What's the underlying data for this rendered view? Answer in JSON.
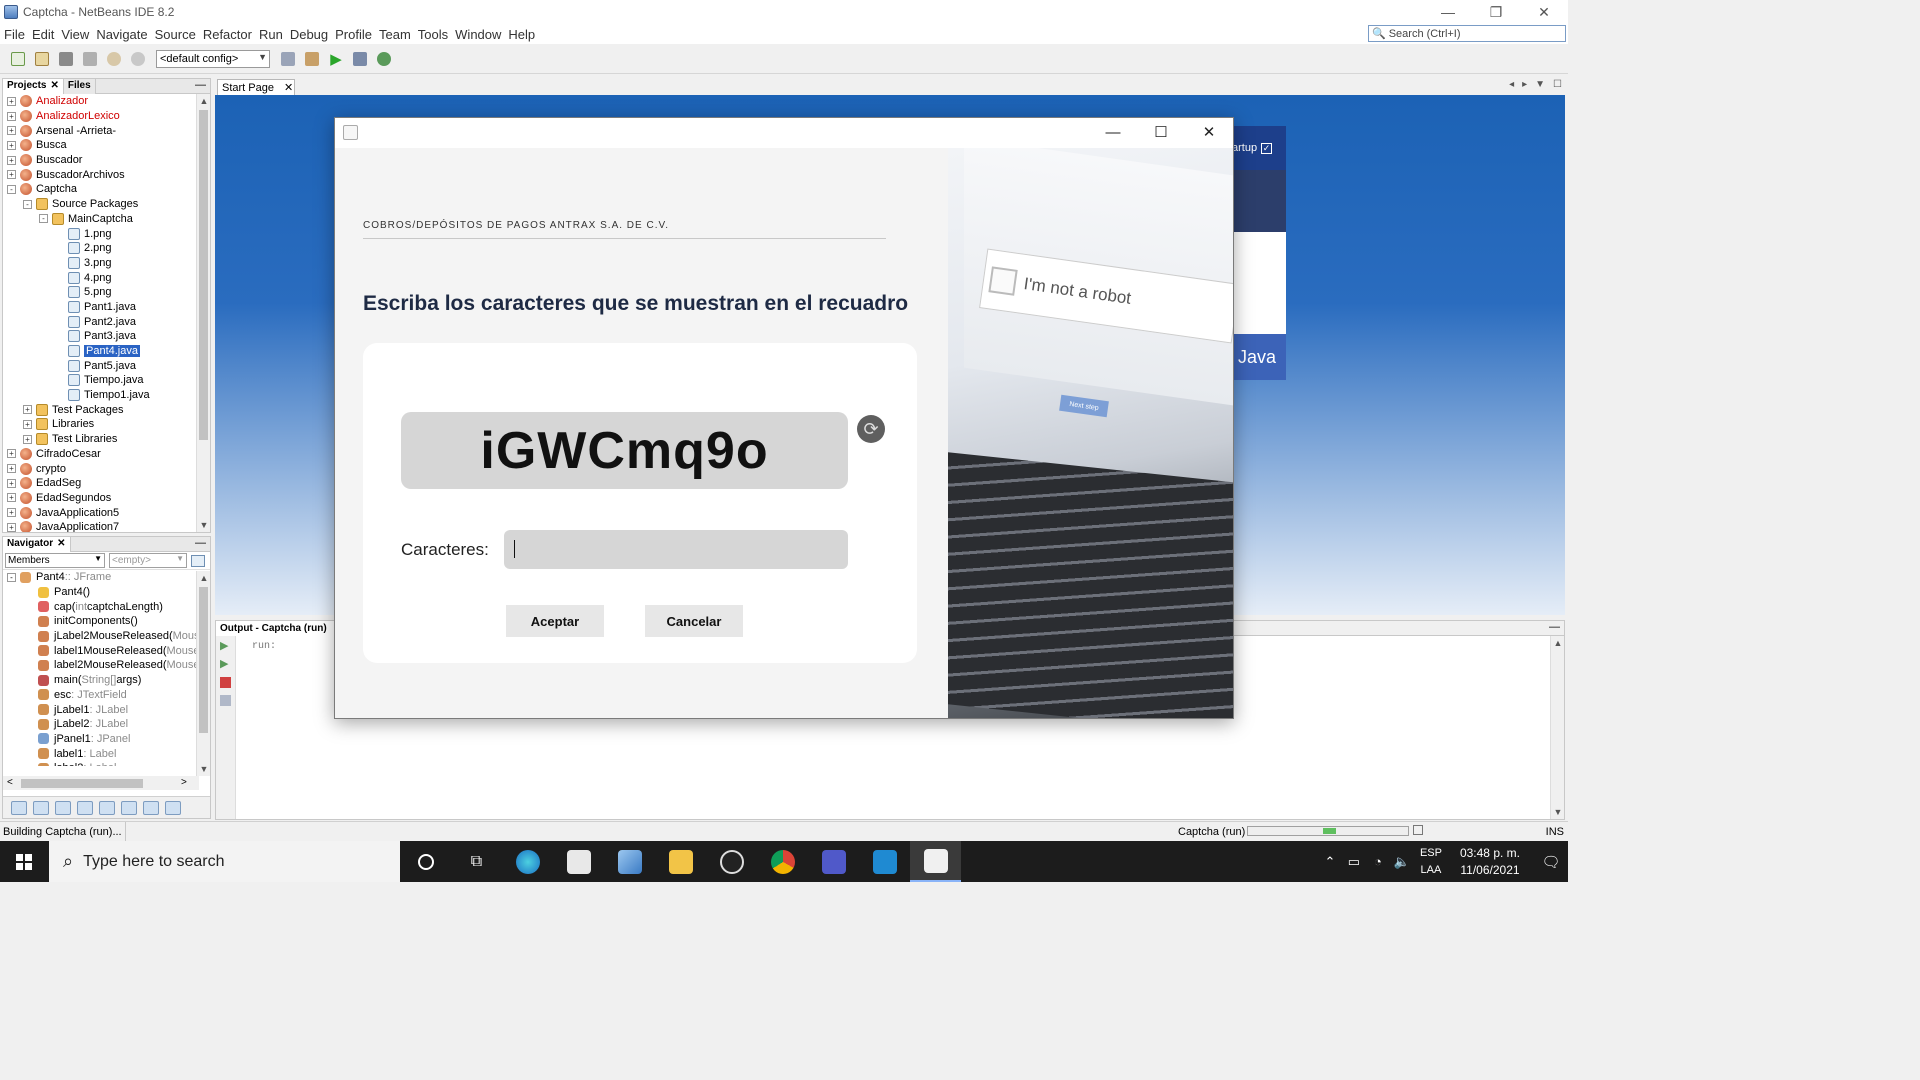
{
  "window": {
    "title": "Captcha - NetBeans IDE 8.2",
    "controls": [
      "—",
      "❐",
      "✕"
    ]
  },
  "menu": [
    "File",
    "Edit",
    "View",
    "Navigate",
    "Source",
    "Refactor",
    "Run",
    "Debug",
    "Profile",
    "Team",
    "Tools",
    "Window",
    "Help"
  ],
  "search": {
    "placeholder": "Search (Ctrl+I)"
  },
  "toolbar": {
    "config": "<default config>"
  },
  "projects": {
    "tabs": [
      "Projects",
      "Files"
    ],
    "items": [
      {
        "label": "Analizador",
        "level": 0,
        "exp": "+",
        "icon": "project",
        "color": "red"
      },
      {
        "label": "AnalizadorLexico",
        "level": 0,
        "exp": "+",
        "icon": "project",
        "color": "red"
      },
      {
        "label": "Arsenal -Arrieta-",
        "level": 0,
        "exp": "+",
        "icon": "project"
      },
      {
        "label": "Busca",
        "level": 0,
        "exp": "+",
        "icon": "project"
      },
      {
        "label": "Buscador",
        "level": 0,
        "exp": "+",
        "icon": "project"
      },
      {
        "label": "BuscadorArchivos",
        "level": 0,
        "exp": "+",
        "icon": "project"
      },
      {
        "label": "Captcha",
        "level": 0,
        "exp": "-",
        "icon": "project"
      },
      {
        "label": "Source Packages",
        "level": 1,
        "exp": "-",
        "icon": "package"
      },
      {
        "label": "MainCaptcha",
        "level": 2,
        "exp": "-",
        "icon": "package"
      },
      {
        "label": "1.png",
        "level": 3,
        "icon": "file"
      },
      {
        "label": "2.png",
        "level": 3,
        "icon": "file"
      },
      {
        "label": "3.png",
        "level": 3,
        "icon": "file"
      },
      {
        "label": "4.png",
        "level": 3,
        "icon": "file"
      },
      {
        "label": "5.png",
        "level": 3,
        "icon": "file"
      },
      {
        "label": "Pant1.java",
        "level": 3,
        "icon": "java"
      },
      {
        "label": "Pant2.java",
        "level": 3,
        "icon": "java"
      },
      {
        "label": "Pant3.java",
        "level": 3,
        "icon": "java"
      },
      {
        "label": "Pant4.java",
        "level": 3,
        "icon": "java",
        "selected": true
      },
      {
        "label": "Pant5.java",
        "level": 3,
        "icon": "java"
      },
      {
        "label": "Tiempo.java",
        "level": 3,
        "icon": "java"
      },
      {
        "label": "Tiempo1.java",
        "level": 3,
        "icon": "java"
      },
      {
        "label": "Test Packages",
        "level": 1,
        "exp": "+",
        "icon": "package"
      },
      {
        "label": "Libraries",
        "level": 1,
        "exp": "+",
        "icon": "package"
      },
      {
        "label": "Test Libraries",
        "level": 1,
        "exp": "+",
        "icon": "package"
      },
      {
        "label": "CifradoCesar",
        "level": 0,
        "exp": "+",
        "icon": "project"
      },
      {
        "label": "crypto",
        "level": 0,
        "exp": "+",
        "icon": "project"
      },
      {
        "label": "EdadSeg",
        "level": 0,
        "exp": "+",
        "icon": "project"
      },
      {
        "label": "EdadSegundos",
        "level": 0,
        "exp": "+",
        "icon": "project"
      },
      {
        "label": "JavaApplication5",
        "level": 0,
        "exp": "+",
        "icon": "project"
      },
      {
        "label": "JavaApplication7",
        "level": 0,
        "exp": "+",
        "icon": "project"
      }
    ]
  },
  "navigator": {
    "title": "Navigator",
    "filter": "Members",
    "filter2": "<empty>",
    "items": [
      {
        "name": "Pant4",
        "type": " :: JFrame",
        "level": 0,
        "icon": "#e0a060"
      },
      {
        "name": "Pant4()",
        "type": "",
        "level": 1,
        "icon": "#f0c040"
      },
      {
        "name": "cap(",
        "arg1": "int",
        "rest": " captchaLength)",
        "level": 1,
        "icon": "#e06060"
      },
      {
        "name": "initComponents()",
        "type": "",
        "level": 1,
        "icon": "#d08050"
      },
      {
        "name": "jLabel2MouseReleased(",
        "type": "Mouse",
        "level": 1,
        "icon": "#d08050"
      },
      {
        "name": "label1MouseReleased(",
        "type": "MouseE",
        "level": 1,
        "icon": "#d08050"
      },
      {
        "name": "label2MouseReleased(",
        "type": "MouseE",
        "level": 1,
        "icon": "#d08050"
      },
      {
        "name": "main(",
        "arg1": "String[]",
        "rest": " args)",
        "level": 1,
        "icon": "#c05050"
      },
      {
        "name": "esc",
        "type": " : JTextField",
        "level": 1,
        "icon": "#d09050"
      },
      {
        "name": "jLabel1",
        "type": " : JLabel",
        "level": 1,
        "icon": "#d09050"
      },
      {
        "name": "jLabel2",
        "type": " : JLabel",
        "level": 1,
        "icon": "#d09050"
      },
      {
        "name": "jPanel1",
        "type": " : JPanel",
        "level": 1,
        "icon": "#7aa0d0"
      },
      {
        "name": "label1",
        "type": " : Label",
        "level": 1,
        "icon": "#d09050"
      },
      {
        "name": "label2",
        "type": " : Label",
        "level": 1,
        "icon": "#d09050"
      }
    ]
  },
  "editor": {
    "tab": "Start Page",
    "startup_label": "artup",
    "java_label": "Java"
  },
  "output": {
    "tab": "Output - Captcha (run)",
    "text": "run:"
  },
  "status": {
    "left": "Building Captcha (run)...",
    "task": "Captcha (run)",
    "progress": 0.55,
    "mode": "INS"
  },
  "dialog": {
    "company": "COBROS/DEPÓSITOS DE PAGOS ANTRAX S.A. DE C.V.",
    "headline": "Escriba los caracteres que se muestran en el recuadro",
    "captcha": "iGWCmq9o",
    "field_label": "Caracteres:",
    "field_value": "",
    "accept": "Aceptar",
    "cancel": "Cancelar",
    "image_text": "I'm not a robot",
    "image_button": "Next step"
  },
  "taskbar": {
    "search_placeholder": "Type here to search",
    "lang_top": "ESP",
    "lang_bottom": "LAA",
    "time": "03:48 p. m.",
    "date": "11/06/2021"
  }
}
